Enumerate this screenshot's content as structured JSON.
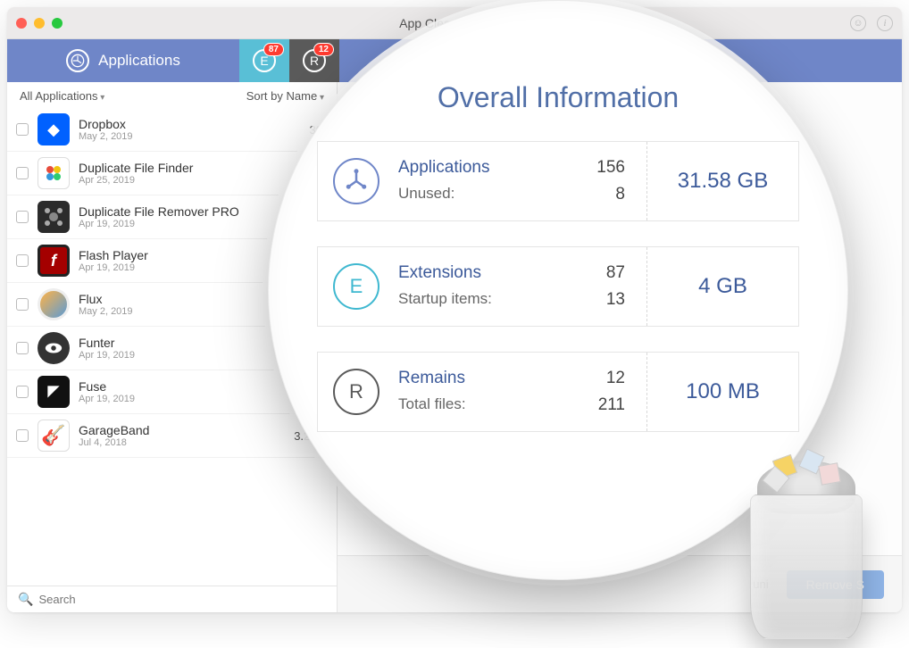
{
  "window": {
    "title": "App Cleaner & Unin"
  },
  "tabs": {
    "applications_label": "Applications",
    "ext_badge": "87",
    "rem_badge": "12"
  },
  "filters": {
    "all": "All Applications",
    "sort": "Sort by Name"
  },
  "apps": [
    {
      "name": "Dropbox",
      "date": "May 2, 2019",
      "size": "30"
    },
    {
      "name": "Duplicate File Finder",
      "date": "Apr 25, 2019",
      "size": ""
    },
    {
      "name": "Duplicate File Remover PRO",
      "date": "Apr 19, 2019",
      "size": ""
    },
    {
      "name": "Flash Player",
      "date": "Apr 19, 2019",
      "size": ""
    },
    {
      "name": "Flux",
      "date": "May 2, 2019",
      "size": ""
    },
    {
      "name": "Funter",
      "date": "Apr 19, 2019",
      "size": ""
    },
    {
      "name": "Fuse",
      "date": "Apr 19, 2019",
      "size": ""
    },
    {
      "name": "GarageBand",
      "date": "Jul 4, 2018",
      "size": "3.2 G"
    }
  ],
  "search_placeholder": "Search",
  "overall": {
    "title": "Overall Information",
    "apps": {
      "label": "Applications",
      "count": "156",
      "sub_label": "Unused:",
      "sub_count": "8",
      "size": "31.58 GB"
    },
    "ext": {
      "label": "Extensions",
      "count": "87",
      "sub_label": "Startup items:",
      "sub_count": "13",
      "size": "4 GB"
    },
    "rem": {
      "label": "Remains",
      "count": "12",
      "sub_label": "Total files:",
      "sub_count": "211",
      "size": "100 MB"
    }
  },
  "bottom": {
    "hint_fragment": "uni",
    "remove_label": "Remove S"
  }
}
